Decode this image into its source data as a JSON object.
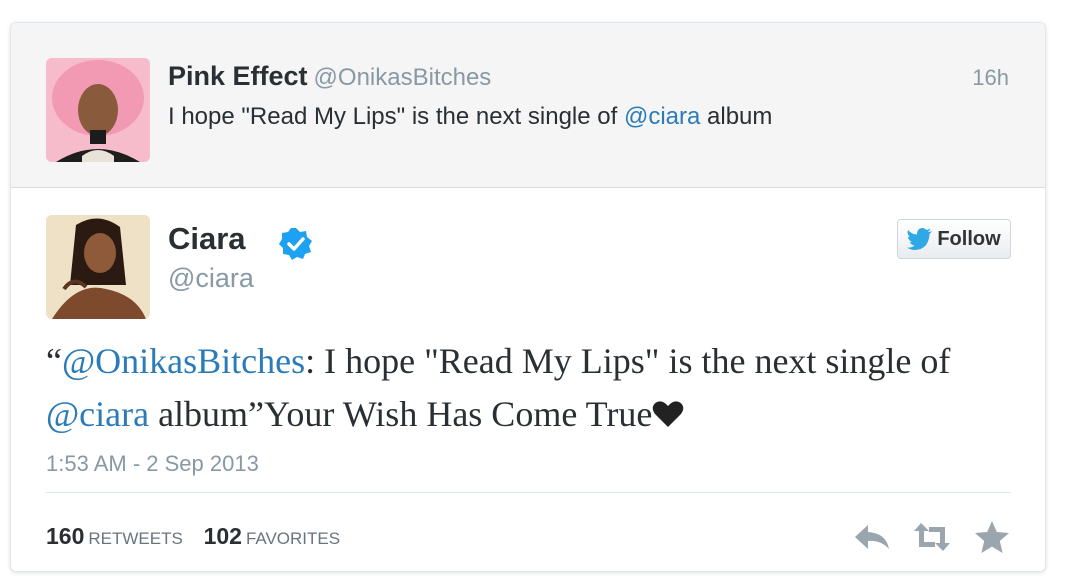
{
  "parent_tweet": {
    "name": "Pink Effect",
    "handle": "@OnikasBitches",
    "time": "16h",
    "text_before": "I hope \"Read My Lips\" is the next single of ",
    "mention": "@ciara",
    "text_after": " album"
  },
  "main_tweet": {
    "name": "Ciara",
    "handle": "@ciara",
    "follow_label": "Follow",
    "quote_open": "“",
    "mention1": "@OnikasBitches",
    "text_part1": ": I hope \"Read My Lips\" is the next single of ",
    "mention2": "@ciara",
    "text_part2": " album”Your Wish Has Come True",
    "date": "1:53 AM - 2 Sep 2013",
    "retweets_count": "160",
    "retweets_label": "RETWEETS",
    "favorites_count": "102",
    "favorites_label": "FAVORITES"
  },
  "colors": {
    "link": "#2b7bb9",
    "verified": "#1da1f2",
    "twitter_bird": "#2fa8e5",
    "muted": "#8899a6",
    "action_icon": "#9aa5ad"
  },
  "icons": [
    "verified-badge-icon",
    "twitter-bird-icon",
    "heart-icon",
    "reply-icon",
    "retweet-icon",
    "favorite-star-icon"
  ]
}
